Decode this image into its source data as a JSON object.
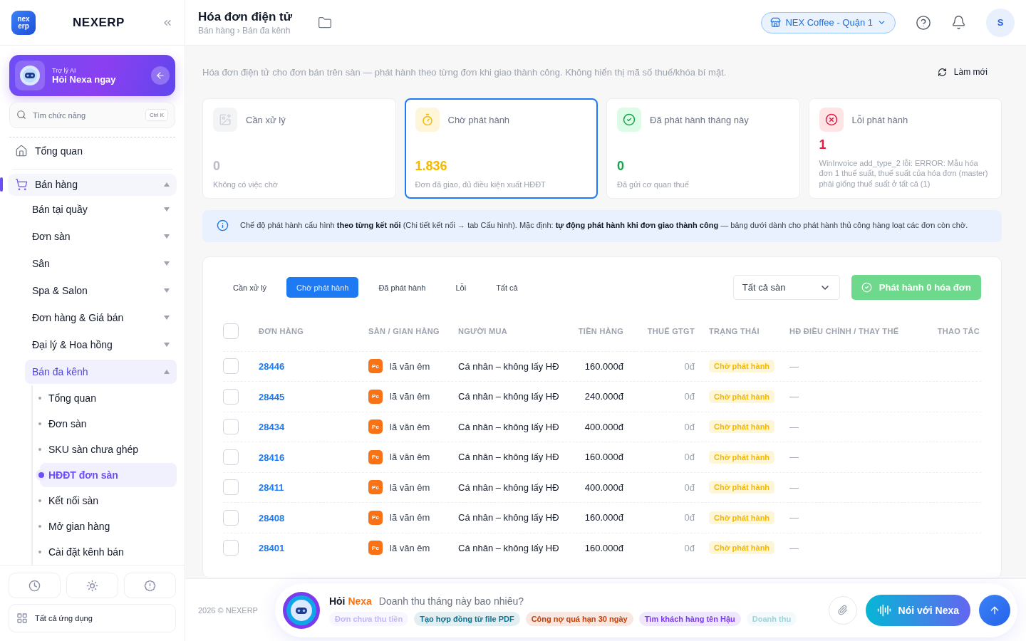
{
  "brand": {
    "name": "NEXERP",
    "logo_top": "nex",
    "logo_bottom": "erp"
  },
  "ai_card": {
    "caption": "Trợ lý AI",
    "title": "Hỏi Nexa ngay"
  },
  "search": {
    "placeholder": "Tìm chức năng",
    "shortcut": "Ctrl K"
  },
  "nav": [
    {
      "label": "Tổng quan",
      "kind": "home",
      "expanded": false
    },
    {
      "label": "Bán hàng",
      "kind": "cart",
      "expanded": true,
      "children": [
        {
          "label": "Bán tại quầy",
          "expanded": false
        },
        {
          "label": "Đơn sàn",
          "expanded": false
        },
        {
          "label": "Sân",
          "expanded": false
        },
        {
          "label": "Spa & Salon",
          "expanded": false
        },
        {
          "label": "Đơn hàng & Giá bán",
          "expanded": false
        },
        {
          "label": "Đại lý & Hoa hồng",
          "expanded": false
        },
        {
          "label": "Bán đa kênh",
          "expanded": true,
          "children": [
            {
              "label": "Tổng quan",
              "selected": false
            },
            {
              "label": "Đơn sàn",
              "selected": false
            },
            {
              "label": "SKU sàn chưa ghép",
              "selected": false
            },
            {
              "label": "HĐĐT đơn sàn",
              "selected": true
            },
            {
              "label": "Kết nối sàn",
              "selected": false
            },
            {
              "label": "Mở gian hàng",
              "selected": false
            },
            {
              "label": "Cài đặt kênh bán",
              "selected": false
            }
          ]
        }
      ]
    }
  ],
  "all_apps": "Tất cả ứng dụng",
  "header": {
    "title": "Hóa đơn điện tử",
    "breadcrumb": "Bán hàng › Bán đa kênh",
    "store": "NEX Coffee - Quận 1",
    "avatar": "S"
  },
  "description": "Hóa đơn điện tử cho đơn bán trên sàn — phát hành theo từng đơn khi giao thành công. Không hiển thị mã số thuế/khóa bí mật.",
  "refresh": "Làm mới",
  "stats": [
    {
      "kind": "pending",
      "label": "Cần xử lý",
      "value": "0",
      "note": "Không có việc chờ",
      "color": "#b8bcc6",
      "selected": false
    },
    {
      "kind": "waiting",
      "label": "Chờ phát hành",
      "value": "1.836",
      "note": "Đơn đã giao, đủ điều kiện xuất HĐĐT",
      "color": "#f5b800",
      "selected": true
    },
    {
      "kind": "done",
      "label": "Đã phát hành tháng này",
      "value": "0",
      "note": "Đã gửi cơ quan thuế",
      "color": "#16a34a",
      "selected": false
    },
    {
      "kind": "error",
      "label": "Lỗi phát hành",
      "value": "1",
      "note": "WinInvoice add_type_2 lỗi: ERROR: Mẫu hóa đơn 1 thuế suất, thuế suất của hóa đơn (master) phải giống thuế suất ở tất cả (1)",
      "color": "#e11d48",
      "selected": false
    }
  ],
  "info": "Chế độ phát hành cấu hình **theo từng kết nối** (Chi tiết kết nối → tab Cấu hình). Mặc định: **tự động phát hành khi đơn giao thành công** — bảng dưới dành cho phát hành thủ công hàng loạt các đơn còn chờ.",
  "tabs": [
    {
      "label": "Cần xử lý",
      "selected": false
    },
    {
      "label": "Chờ phát hành",
      "selected": true
    },
    {
      "label": "Đã phát hành",
      "selected": false
    },
    {
      "label": "Lỗi",
      "selected": false
    },
    {
      "label": "Tất cả",
      "selected": false
    }
  ],
  "platform_filter": "Tất cả sàn",
  "issue_button": {
    "label": "Phát hành 0 hóa đơn",
    "disabled": true
  },
  "table": {
    "select_all_checked": false,
    "columns": [
      "ĐƠN HÀNG",
      "SÀN / GIAN HÀNG",
      "NGƯỜI MUA",
      "TIỀN HÀNG",
      "THUẾ GTGT",
      "TRẠNG THÁI",
      "HĐ ĐIỀU CHỈNH / THAY THẾ",
      "THAO TÁC"
    ],
    "rows": [
      {
        "order": "28446",
        "platform": "Pc",
        "shop": "lã văn êm",
        "buyer": "Cá nhân – không lấy HĐ",
        "amount": "160.000đ",
        "tax": "0đ",
        "status": "Chờ phát hành",
        "adjust": "—",
        "checked": false
      },
      {
        "order": "28445",
        "platform": "Pc",
        "shop": "lã văn êm",
        "buyer": "Cá nhân – không lấy HĐ",
        "amount": "240.000đ",
        "tax": "0đ",
        "status": "Chờ phát hành",
        "adjust": "—",
        "checked": false
      },
      {
        "order": "28434",
        "platform": "Pc",
        "shop": "lã văn êm",
        "buyer": "Cá nhân – không lấy HĐ",
        "amount": "400.000đ",
        "tax": "0đ",
        "status": "Chờ phát hành",
        "adjust": "—",
        "checked": false
      },
      {
        "order": "28416",
        "platform": "Pc",
        "shop": "lã văn êm",
        "buyer": "Cá nhân – không lấy HĐ",
        "amount": "160.000đ",
        "tax": "0đ",
        "status": "Chờ phát hành",
        "adjust": "—",
        "checked": false
      },
      {
        "order": "28411",
        "platform": "Pc",
        "shop": "lã văn êm",
        "buyer": "Cá nhân – không lấy HĐ",
        "amount": "400.000đ",
        "tax": "0đ",
        "status": "Chờ phát hành",
        "adjust": "—",
        "checked": false
      },
      {
        "order": "28408",
        "platform": "Pc",
        "shop": "lã văn êm",
        "buyer": "Cá nhân – không lấy HĐ",
        "amount": "160.000đ",
        "tax": "0đ",
        "status": "Chờ phát hành",
        "adjust": "—",
        "checked": false
      },
      {
        "order": "28401",
        "platform": "Pc",
        "shop": "lã văn êm",
        "buyer": "Cá nhân – không lấy HĐ",
        "amount": "160.000đ",
        "tax": "0đ",
        "status": "Chờ phát hành",
        "adjust": "—",
        "checked": false
      }
    ]
  },
  "footer": {
    "copyright": "2026 © NEXERP"
  },
  "assistant": {
    "title_a": "Hỏi",
    "title_b": "Nexa",
    "placeholder": "Doanh thu tháng này bao nhiêu?",
    "voice_button": "Nói với Nexa",
    "chips": [
      {
        "label": "Đơn chưa thu tiền",
        "color": "#c4b5fd"
      },
      {
        "label": "Tạo hợp đồng từ file PDF",
        "color": "#0e7490"
      },
      {
        "label": "Công nợ quá hạn 30 ngày",
        "color": "#c2410c"
      },
      {
        "label": "Tìm khách hàng tên Hậu",
        "color": "#7c3aed"
      },
      {
        "label": "Doanh thu",
        "color": "#9fd3dc"
      }
    ]
  }
}
